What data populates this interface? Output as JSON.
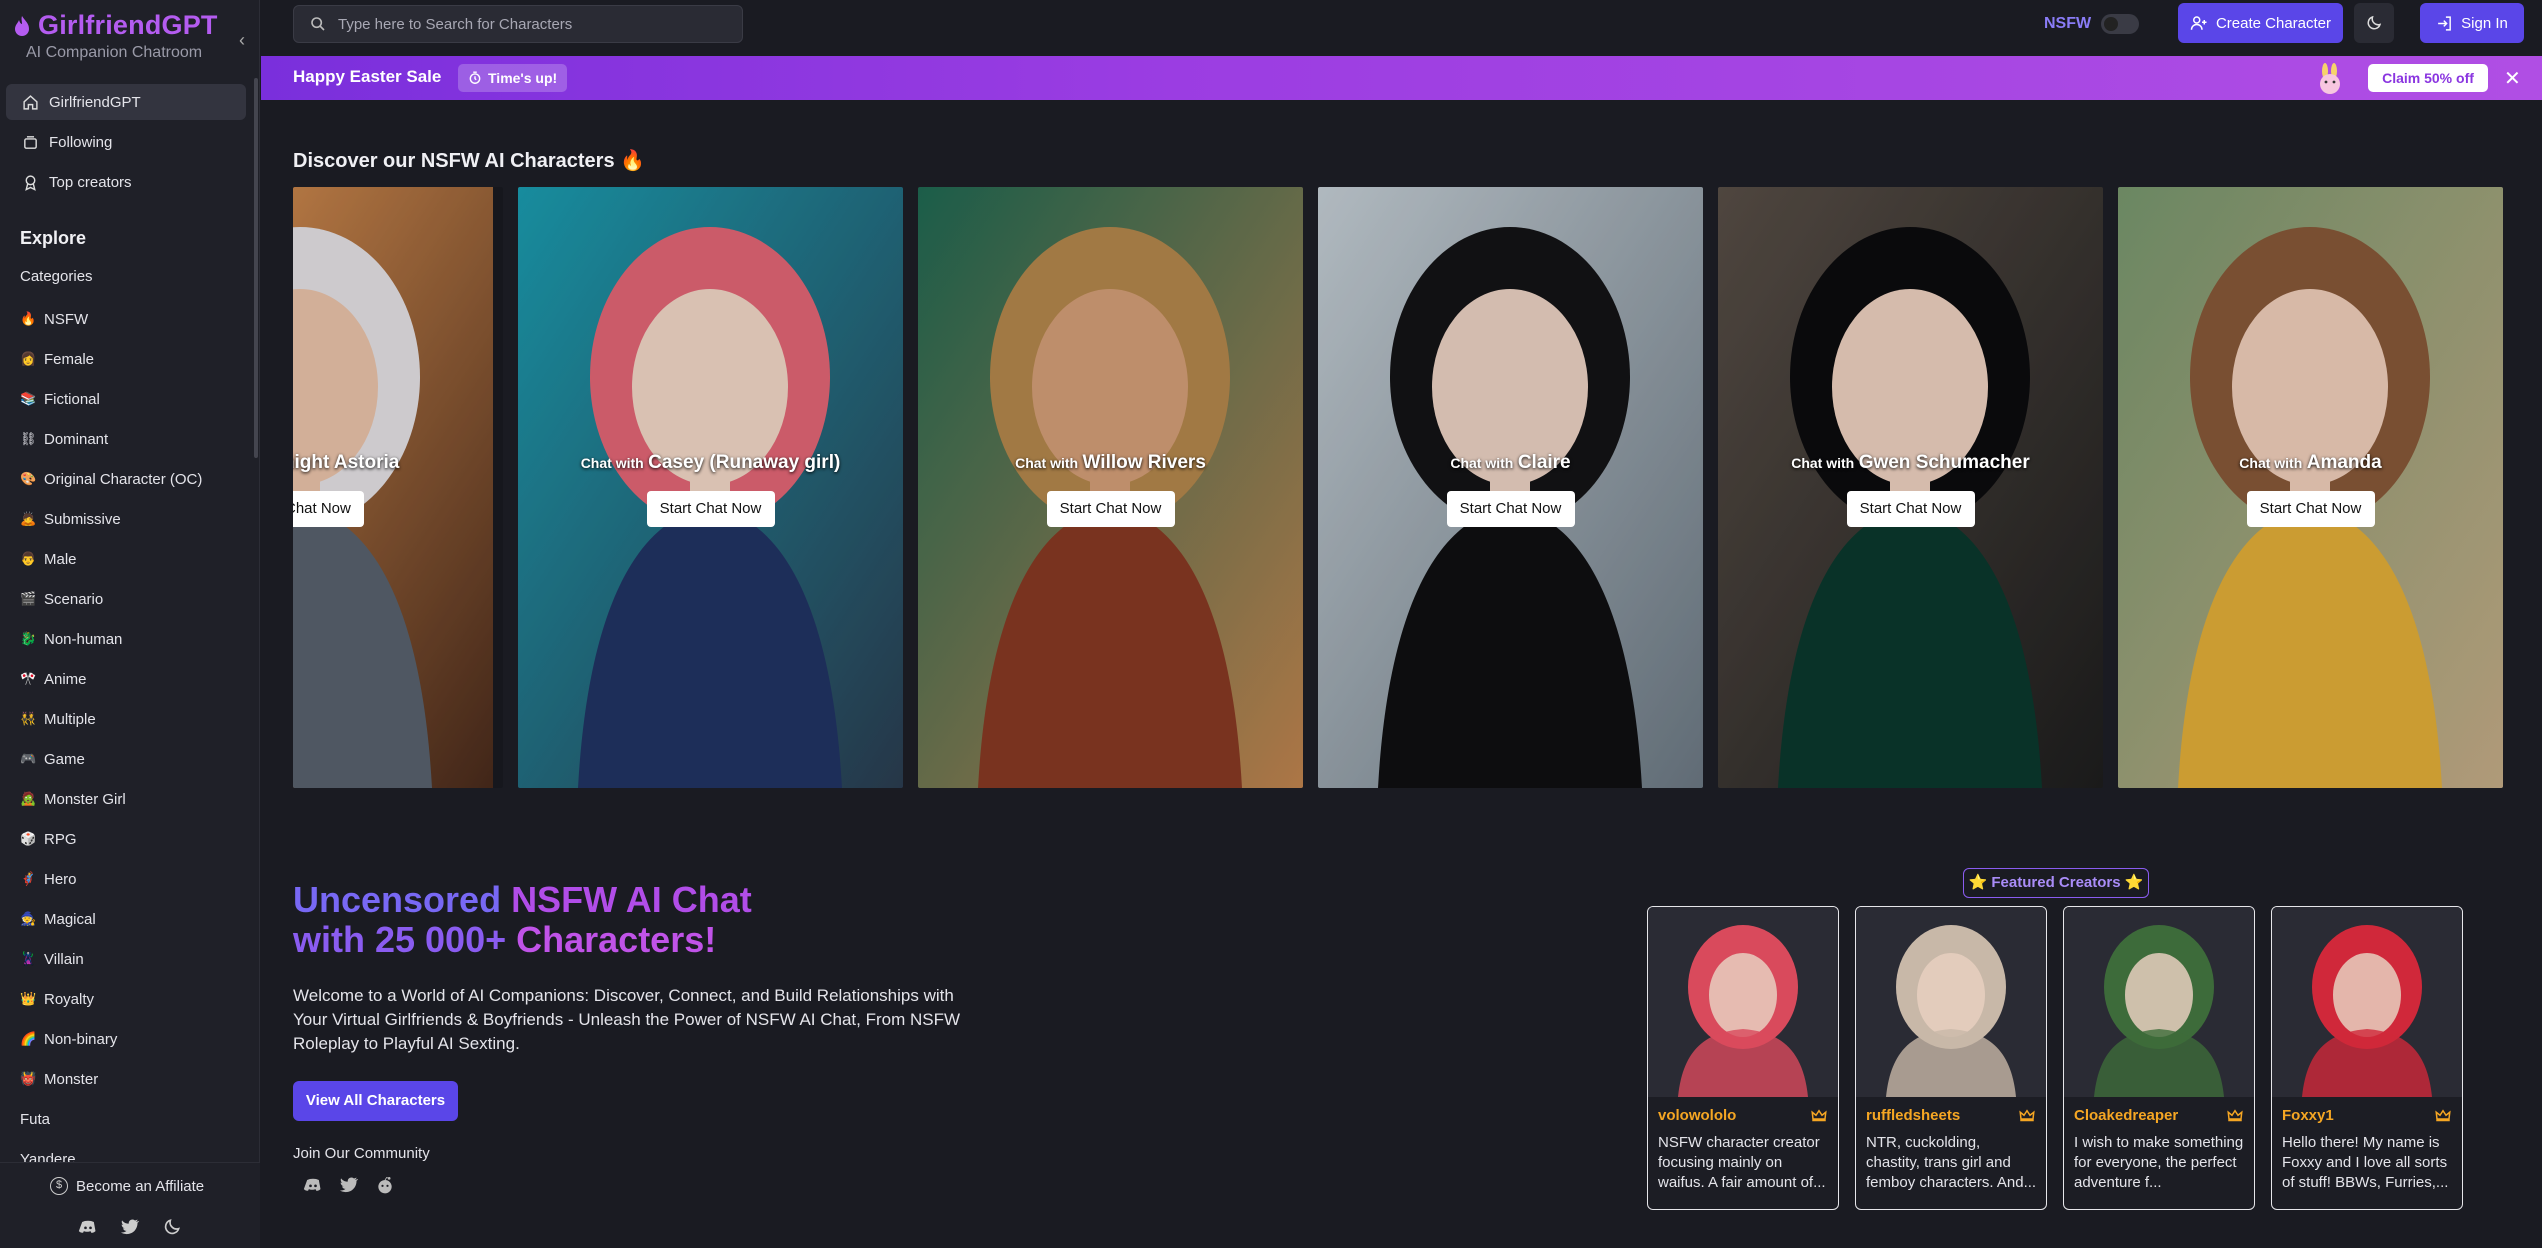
{
  "sidebar": {
    "brand": "GirlfriendGPT",
    "tagline": "AI Companion Chatroom",
    "nav": [
      {
        "label": "GirlfriendGPT",
        "icon": "home-icon"
      },
      {
        "label": "Following",
        "icon": "following-icon"
      },
      {
        "label": "Top creators",
        "icon": "award-icon"
      }
    ],
    "explore": "Explore",
    "categories_label": "Categories",
    "categories": [
      {
        "emoji": "🔥",
        "label": "NSFW"
      },
      {
        "emoji": "👩",
        "label": "Female"
      },
      {
        "emoji": "📚",
        "label": "Fictional"
      },
      {
        "emoji": "⛓",
        "label": "Dominant"
      },
      {
        "emoji": "🎨",
        "label": "Original Character (OC)"
      },
      {
        "emoji": "🙇",
        "label": "Submissive"
      },
      {
        "emoji": "👨",
        "label": "Male"
      },
      {
        "emoji": "🎬",
        "label": "Scenario"
      },
      {
        "emoji": "🐉",
        "label": "Non-human"
      },
      {
        "emoji": "🎌",
        "label": "Anime"
      },
      {
        "emoji": "👯",
        "label": "Multiple"
      },
      {
        "emoji": "🎮",
        "label": "Game"
      },
      {
        "emoji": "🧟",
        "label": "Monster Girl"
      },
      {
        "emoji": "🎲",
        "label": "RPG"
      },
      {
        "emoji": "🦸",
        "label": "Hero"
      },
      {
        "emoji": "🧙",
        "label": "Magical"
      },
      {
        "emoji": "🦹",
        "label": "Villain"
      },
      {
        "emoji": "👑",
        "label": "Royalty"
      },
      {
        "emoji": "🌈",
        "label": "Non-binary"
      },
      {
        "emoji": "👹",
        "label": "Monster"
      },
      {
        "emoji": "",
        "label": "Futa"
      },
      {
        "emoji": "",
        "label": "Yandere"
      }
    ],
    "affiliate": "Become an Affiliate"
  },
  "header": {
    "search_placeholder": "Type here to Search for Characters",
    "nsfw_label": "NSFW",
    "nsfw_enabled": false,
    "create_label": "Create Character",
    "signin_label": "Sign In"
  },
  "promo": {
    "title": "Happy Easter Sale",
    "badge": "Time's up!",
    "claim": "Claim 50% off"
  },
  "characters": {
    "title": "Discover our NSFW AI Characters 🔥",
    "chat_with": "Chat with",
    "items": [
      {
        "name": "Knight Astoria",
        "button": "Start Chat Now"
      },
      {
        "name": "Casey (Runaway girl)",
        "button": "Start Chat Now"
      },
      {
        "name": "Willow Rivers",
        "button": "Start Chat Now"
      },
      {
        "name": "Claire",
        "button": "Start Chat Now"
      },
      {
        "name": "Gwen Schumacher",
        "button": "Start Chat Now"
      },
      {
        "name": "Amanda",
        "button": "Start Chat Now"
      }
    ]
  },
  "hero": {
    "line1_a": "Uncensored ",
    "line1_b": "NSFW AI Chat",
    "line2_a": "with 25 000+ ",
    "line2_b": "Characters!",
    "description": "Welcome to a World of AI Companions: Discover, Connect, and Build Relationships with Your Virtual Girlfriends & Boyfriends - Unleash the Power of NSFW AI Chat, From NSFW Roleplay to Playful AI Sexting.",
    "button": "View All Characters",
    "community": "Join Our Community"
  },
  "featured": {
    "badge": "⭐ Featured Creators ⭐",
    "creators": [
      {
        "name": "volowololo",
        "desc": "NSFW character creator focusing mainly on waifus. A fair amount of...",
        "accent": "#d94a5c"
      },
      {
        "name": "ruffledsheets",
        "desc": "NTR, cuckolding, chastity, trans girl and femboy characters. And...",
        "accent": "#c8b8a8"
      },
      {
        "name": "Cloakedreaper",
        "desc": "I wish to make something for everyone, the perfect adventure f...",
        "accent": "#3d6b3a"
      },
      {
        "name": "Foxxy1",
        "desc": "Hello there! My name is Foxxy and I love all sorts of stuff! BBWs, Furries,...",
        "accent": "#d0283a"
      }
    ]
  },
  "colors": {
    "accent": "#5a46e8",
    "brand": "#b45cf0",
    "promo": "#9b3de2",
    "creator_name": "#f5a623"
  }
}
